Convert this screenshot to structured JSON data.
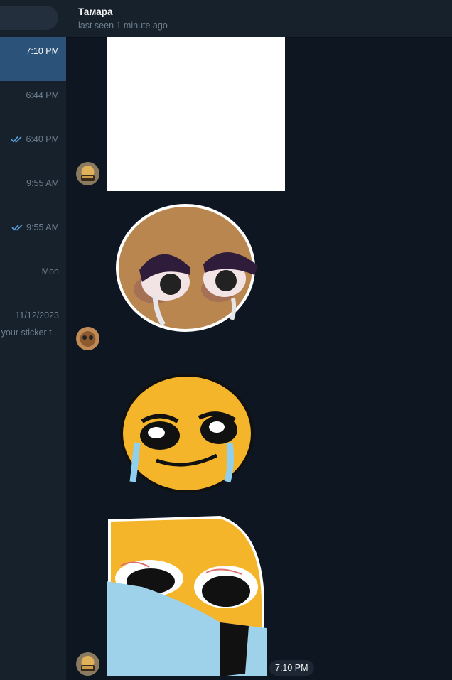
{
  "sidebar": {
    "items": [
      {
        "time": "7:10 PM",
        "active": true,
        "read_check": false,
        "preview": ""
      },
      {
        "time": "6:44 PM",
        "active": false,
        "read_check": false,
        "preview": ""
      },
      {
        "time": "6:40 PM",
        "active": false,
        "read_check": true,
        "preview": ""
      },
      {
        "time": "9:55 AM",
        "active": false,
        "read_check": false,
        "preview": ""
      },
      {
        "time": "9:55 AM",
        "active": false,
        "read_check": true,
        "preview": ""
      },
      {
        "time": "Mon",
        "active": false,
        "read_check": false,
        "preview": ""
      },
      {
        "time": "11/12/2023",
        "active": false,
        "read_check": false,
        "preview": "your sticker t..."
      }
    ]
  },
  "header": {
    "name": "Тамара",
    "status": "last seen 1 minute ago"
  },
  "messages": {
    "last_time": "7:10 PM"
  },
  "colors": {
    "background": "#0e1621",
    "sidebar": "#17212b",
    "active_item": "#2b5278",
    "check": "#5fa8e6"
  },
  "icons": [
    "double-check-icon",
    "avatar",
    "sticker"
  ]
}
